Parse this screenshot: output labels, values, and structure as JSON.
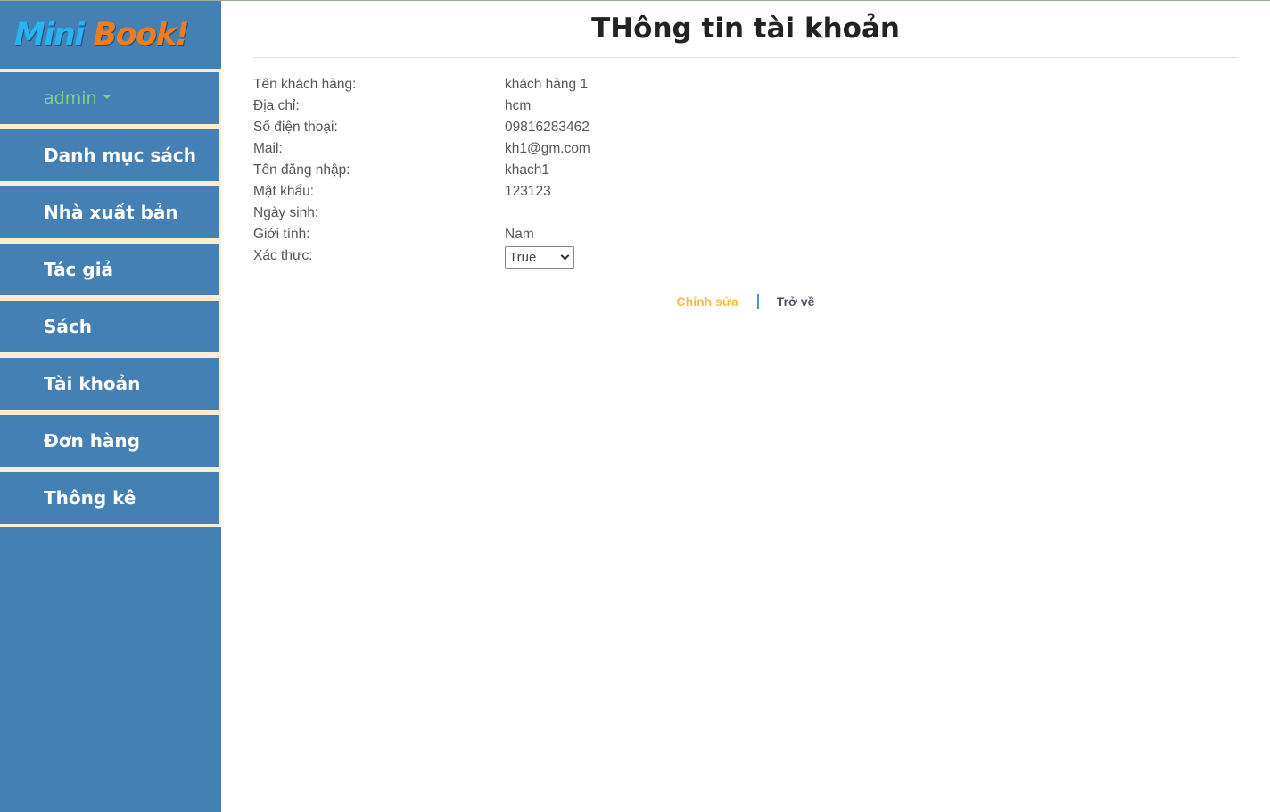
{
  "brand": {
    "part1": "Mini ",
    "part2": "Book!"
  },
  "sidebar": {
    "user_label": "admin",
    "items": [
      {
        "label": "Danh mục sách"
      },
      {
        "label": "Nhà xuất bản"
      },
      {
        "label": "Tác giả"
      },
      {
        "label": "Sách"
      },
      {
        "label": "Tài khoản"
      },
      {
        "label": "Đơn hàng"
      },
      {
        "label": "Thông kê"
      }
    ]
  },
  "page": {
    "title": "THông tin tài khoản"
  },
  "account": {
    "rows": [
      {
        "label": "Tên khách hàng:",
        "value": "khách hàng 1"
      },
      {
        "label": "Địa chỉ:",
        "value": "hcm"
      },
      {
        "label": "Số điện thoại:",
        "value": "09816283462"
      },
      {
        "label": "Mail:",
        "value": "kh1@gm.com"
      },
      {
        "label": "Tên đăng nhập:",
        "value": "khach1"
      },
      {
        "label": "Mật khẩu:",
        "value": "123123"
      },
      {
        "label": "Ngày sinh:",
        "value": ""
      },
      {
        "label": "Giới tính:",
        "value": "Nam"
      }
    ],
    "verify": {
      "label": "Xác thực:",
      "selected": "True"
    }
  },
  "actions": {
    "edit_label": "Chỉnh sửa",
    "back_label": "Trở về"
  },
  "colors": {
    "sidebar_bg": "#4580b4",
    "menu_border": "#fcecd0",
    "admin_text": "#7fd183",
    "edit_link": "#f2bd4e",
    "logo_mini": "#29b3f0",
    "logo_book": "#f07c1c"
  }
}
